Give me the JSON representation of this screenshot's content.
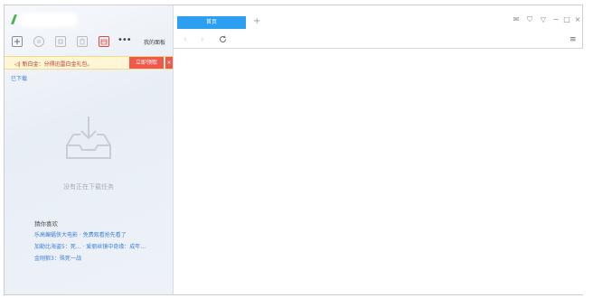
{
  "sidebar": {
    "toolbar": {
      "icons": [
        "new-task-icon",
        "pause-icon",
        "stop-icon",
        "delete-icon",
        "calendar-icon",
        "more-icon"
      ],
      "more_label": "•••",
      "my_downloads": "我的面板"
    },
    "banner": {
      "text": "◁| 新白金：分得迅雷白金礼包。",
      "button": "立即领取",
      "close": "×"
    },
    "downloaded_link": "已下载",
    "empty_message": "没有正在下载任务",
    "recommend": {
      "title": "猜你喜欢",
      "items": [
        "乐高蝙蝠侠大电影 · 免费观看抢先看了",
        "加勒比海盗5：死... · 爱丽丝镜中奇缘：成年...",
        "金刚狼3：殊死一战"
      ]
    }
  },
  "browser": {
    "tab_label": "首页",
    "new_tab": "+",
    "window_controls": [
      "mail-icon",
      "shirt-icon",
      "dropdown-icon",
      "minimize-icon",
      "maximize-icon",
      "close-icon"
    ],
    "window_glyphs": [
      "✉",
      "⛉",
      "▽",
      "−",
      "□",
      "×"
    ],
    "nav": {
      "back": "‹",
      "forward": "›",
      "refresh": "C",
      "menu": "≡"
    }
  },
  "colors": {
    "accent": "#2d9ff0",
    "banner_button": "#f0584a",
    "link": "#3a7fd5"
  }
}
